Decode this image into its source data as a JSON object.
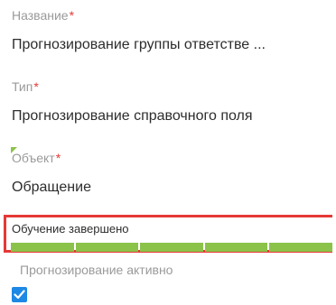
{
  "fields": {
    "name": {
      "label": "Название",
      "required_mark": "*",
      "value": "Прогнозирование группы ответстве ..."
    },
    "type": {
      "label": "Тип",
      "required_mark": "*",
      "value": "Прогнозирование справочного поля"
    },
    "object": {
      "label": "Объект",
      "required_mark": "*",
      "value": "Обращение"
    }
  },
  "training": {
    "status": "Обучение завершено",
    "progress_fraction": 1.0,
    "progress_color": "#8bc34a"
  },
  "prediction_active": {
    "label": "Прогнозирование активно",
    "checked": true
  },
  "colors": {
    "required": "#e53935",
    "highlight_border": "#e53935",
    "checkbox": "#1e88e5",
    "label": "#9a9a9a",
    "value": "#2d2d2d"
  },
  "icons": {
    "checkbox": "checkmark-icon",
    "corner": "green-corner-indicator"
  }
}
